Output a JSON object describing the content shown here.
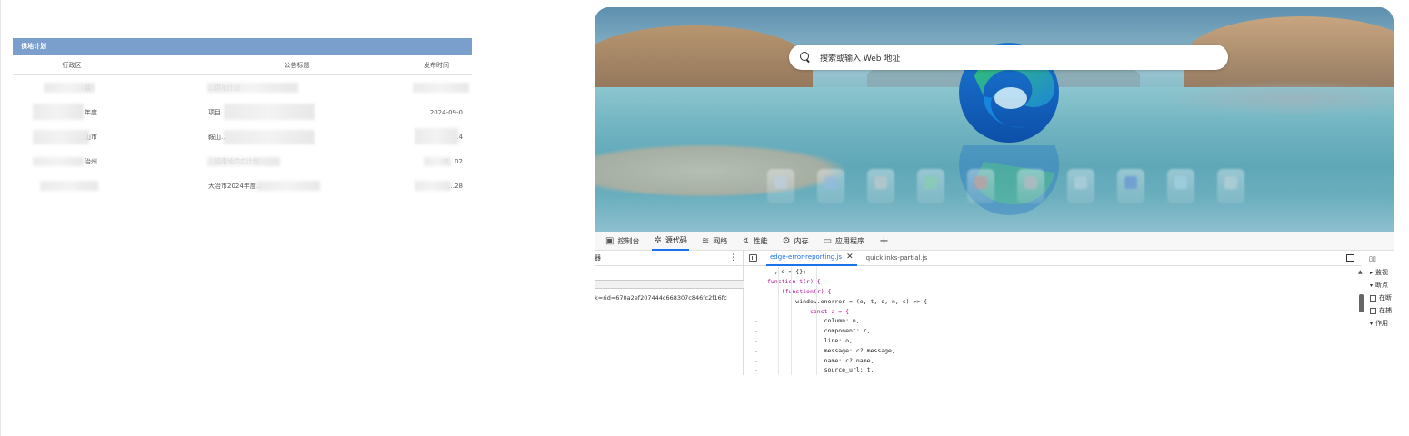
{
  "supply_plan": {
    "header": "供地计划",
    "columns": {
      "region": "行政区",
      "title": "公告标题",
      "date": "发布时间"
    },
    "rows": [
      {
        "region": "…盐",
        "title": "…供地计划",
        "date": ""
      },
      {
        "region": "…年度…",
        "title": "项目…",
        "date": "2024-09-0"
      },
      {
        "region": "…山市",
        "title": "鞍山…",
        "date": "…4"
      },
      {
        "region": "…治州…",
        "title": "…设用地供应计划",
        "date": "2…02"
      },
      {
        "region": "…",
        "title": "大冶市2024年度…",
        "date": "…28"
      }
    ]
  },
  "browser": {
    "search_placeholder": "搜索或输入 Web 地址",
    "devtools_tabs": [
      {
        "icon": "console-icon",
        "label": "控制台"
      },
      {
        "icon": "sources-icon",
        "label": "源代码",
        "active": true
      },
      {
        "icon": "network-icon",
        "label": "网络"
      },
      {
        "icon": "performance-icon",
        "label": "性能"
      },
      {
        "icon": "memory-icon",
        "label": "内存"
      },
      {
        "icon": "application-icon",
        "label": "应用程序"
      }
    ],
    "navigator_label": "器",
    "navigator_url": "k=rid=670a2ef207444c668307c846fc2f16fc",
    "editor_tabs": [
      {
        "label": "edge-error-reporting.js",
        "active": true
      },
      {
        "label": "quicklinks-partial.js"
      }
    ],
    "code_lines": [
      "  , e = {};",
      "function t(r) {",
      "    !function(r) {",
      "        window.onerror = (e, t, o, n, c) => {",
      "            const a = {",
      "                column: n,",
      "                component: r,",
      "                line: o,",
      "                message: c?.message,",
      "                name: c?.name,",
      "                source_url: t,"
    ],
    "side_labels": {
      "watch": "监视",
      "breakpoints": "断点",
      "opt1": "在断",
      "opt2": "在捕",
      "scope": "作用"
    }
  }
}
